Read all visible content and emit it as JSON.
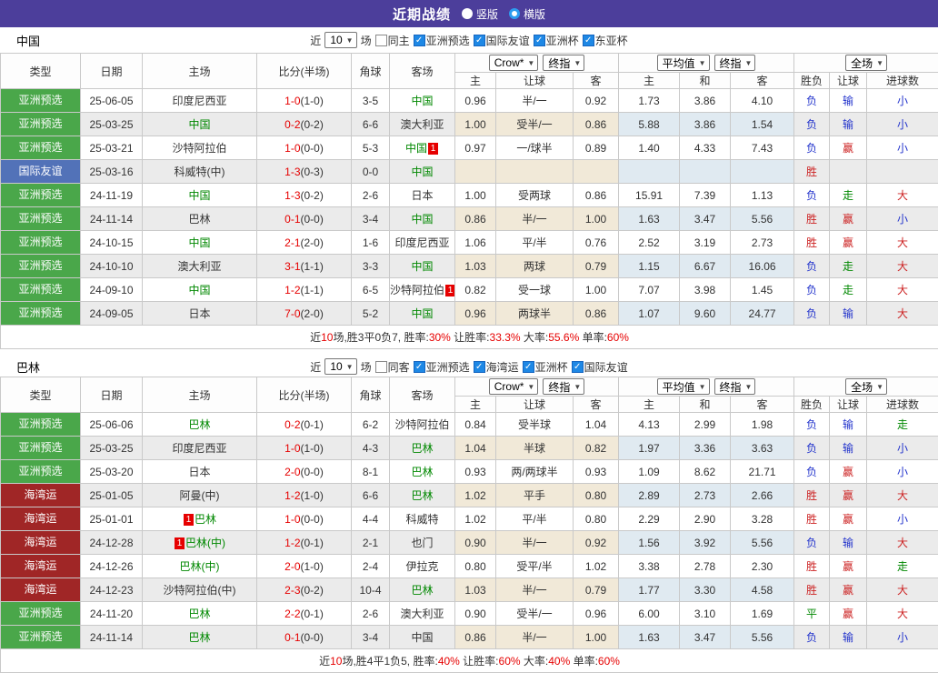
{
  "header": {
    "title": "近期战绩",
    "radio_vertical": "竖版",
    "radio_horizontal": "横版"
  },
  "columns": {
    "type": "类型",
    "date": "日期",
    "home": "主场",
    "score": "比分(半场)",
    "corner": "角球",
    "away": "客场",
    "odds_provider": "Crow*",
    "odds_final": "终指",
    "odds_home": "主",
    "odds_handicap": "让球",
    "odds_away": "客",
    "avg_label": "平均值",
    "avg_final": "终指",
    "avg_home": "主",
    "avg_draw": "和",
    "avg_away": "客",
    "full_label": "全场",
    "res_wl": "胜负",
    "res_handicap": "让球",
    "res_goals": "进球数"
  },
  "sections": [
    {
      "team": "中国",
      "filter": {
        "near": "近",
        "count": "10",
        "games": "场",
        "same": "同主",
        "comps": [
          "亚洲预选",
          "国际友谊",
          "亚洲杯",
          "东亚杯"
        ]
      },
      "rows": [
        {
          "type": "亚洲预选",
          "tc": "green",
          "date": "25-06-05",
          "home": "印度尼西亚",
          "score": "1-0",
          "half": "1-0",
          "corner": "3-5",
          "away": "中国",
          "ah": true,
          "o1": "0.96",
          "o2": "半/一",
          "o3": "0.92",
          "a1": "1.73",
          "a2": "3.86",
          "a3": "4.10",
          "r1": "负",
          "c1": "blue",
          "r2": "输",
          "c2": "blue",
          "r3": "小",
          "c3": "blue"
        },
        {
          "type": "亚洲预选",
          "tc": "green",
          "date": "25-03-25",
          "home": "中国",
          "hh": true,
          "score": "0-2",
          "half": "0-2",
          "corner": "6-6",
          "away": "澳大利亚",
          "o1": "1.00",
          "o2": "受半/一",
          "o3": "0.86",
          "a1": "5.88",
          "a2": "3.86",
          "a3": "1.54",
          "r1": "负",
          "c1": "blue",
          "r2": "输",
          "c2": "blue",
          "r3": "小",
          "c3": "blue"
        },
        {
          "type": "亚洲预选",
          "tc": "green",
          "date": "25-03-21",
          "home": "沙特阿拉伯",
          "score": "1-0",
          "half": "0-0",
          "corner": "5-3",
          "away": "中国",
          "ah": true,
          "acard": "1",
          "o1": "0.97",
          "o2": "一/球半",
          "o3": "0.89",
          "a1": "1.40",
          "a2": "4.33",
          "a3": "7.43",
          "r1": "负",
          "c1": "blue",
          "r2": "赢",
          "c2": "red",
          "r3": "小",
          "c3": "blue"
        },
        {
          "type": "国际友谊",
          "tc": "blue",
          "date": "25-03-16",
          "home": "科威特(中)",
          "score": "1-3",
          "half": "0-3",
          "corner": "0-0",
          "away": "中国",
          "ah": true,
          "o1": "",
          "o2": "",
          "o3": "",
          "a1": "",
          "a2": "",
          "a3": "",
          "r1": "胜",
          "c1": "red",
          "r2": "",
          "r3": ""
        },
        {
          "type": "亚洲预选",
          "tc": "green",
          "date": "24-11-19",
          "home": "中国",
          "hh": true,
          "score": "1-3",
          "half": "0-2",
          "corner": "2-6",
          "away": "日本",
          "o1": "1.00",
          "o2": "受两球",
          "o3": "0.86",
          "a1": "15.91",
          "a2": "7.39",
          "a3": "1.13",
          "r1": "负",
          "c1": "blue",
          "r2": "走",
          "c2": "green",
          "r3": "大",
          "c3": "red"
        },
        {
          "type": "亚洲预选",
          "tc": "green",
          "date": "24-11-14",
          "home": "巴林",
          "score": "0-1",
          "half": "0-0",
          "corner": "3-4",
          "away": "中国",
          "ah": true,
          "o1": "0.86",
          "o2": "半/一",
          "o3": "1.00",
          "a1": "1.63",
          "a2": "3.47",
          "a3": "5.56",
          "r1": "胜",
          "c1": "red",
          "r2": "赢",
          "c2": "red",
          "r3": "小",
          "c3": "blue"
        },
        {
          "type": "亚洲预选",
          "tc": "green",
          "date": "24-10-15",
          "home": "中国",
          "hh": true,
          "score": "2-1",
          "half": "2-0",
          "corner": "1-6",
          "away": "印度尼西亚",
          "o1": "1.06",
          "o2": "平/半",
          "o3": "0.76",
          "a1": "2.52",
          "a2": "3.19",
          "a3": "2.73",
          "r1": "胜",
          "c1": "red",
          "r2": "赢",
          "c2": "red",
          "r3": "大",
          "c3": "red"
        },
        {
          "type": "亚洲预选",
          "tc": "green",
          "date": "24-10-10",
          "home": "澳大利亚",
          "score": "3-1",
          "half": "1-1",
          "corner": "3-3",
          "away": "中国",
          "ah": true,
          "o1": "1.03",
          "o2": "两球",
          "o3": "0.79",
          "a1": "1.15",
          "a2": "6.67",
          "a3": "16.06",
          "r1": "负",
          "c1": "blue",
          "r2": "走",
          "c2": "green",
          "r3": "大",
          "c3": "red"
        },
        {
          "type": "亚洲预选",
          "tc": "green",
          "date": "24-09-10",
          "home": "中国",
          "hh": true,
          "score": "1-2",
          "half": "1-1",
          "corner": "6-5",
          "away": "沙特阿拉伯",
          "acard": "1",
          "o1": "0.82",
          "o2": "受一球",
          "o3": "1.00",
          "a1": "7.07",
          "a2": "3.98",
          "a3": "1.45",
          "r1": "负",
          "c1": "blue",
          "r2": "走",
          "c2": "green",
          "r3": "大",
          "c3": "red"
        },
        {
          "type": "亚洲预选",
          "tc": "green",
          "date": "24-09-05",
          "home": "日本",
          "score": "7-0",
          "half": "2-0",
          "corner": "5-2",
          "away": "中国",
          "ah": true,
          "o1": "0.96",
          "o2": "两球半",
          "o3": "0.86",
          "a1": "1.07",
          "a2": "9.60",
          "a3": "24.77",
          "r1": "负",
          "c1": "blue",
          "r2": "输",
          "c2": "blue",
          "r3": "大",
          "c3": "red"
        }
      ],
      "summary": [
        {
          "t": "近"
        },
        {
          "t": "10",
          "red": true
        },
        {
          "t": "场,胜3平0负7, 胜率:"
        },
        {
          "t": "30%",
          "red": true
        },
        {
          "t": " 让胜率:"
        },
        {
          "t": "33.3%",
          "red": true
        },
        {
          "t": " 大率:"
        },
        {
          "t": "55.6%",
          "red": true
        },
        {
          "t": " 单率:"
        },
        {
          "t": "60%",
          "red": true
        }
      ]
    },
    {
      "team": "巴林",
      "filter": {
        "near": "近",
        "count": "10",
        "games": "场",
        "same": "同客",
        "comps": [
          "亚洲预选",
          "海湾运",
          "亚洲杯",
          "国际友谊"
        ]
      },
      "rows": [
        {
          "type": "亚洲预选",
          "tc": "green",
          "date": "25-06-06",
          "home": "巴林",
          "hh": true,
          "score": "0-2",
          "half": "0-1",
          "corner": "6-2",
          "away": "沙特阿拉伯",
          "o1": "0.84",
          "o2": "受半球",
          "o3": "1.04",
          "a1": "4.13",
          "a2": "2.99",
          "a3": "1.98",
          "r1": "负",
          "c1": "blue",
          "r2": "输",
          "c2": "blue",
          "r3": "走",
          "c3": "green"
        },
        {
          "type": "亚洲预选",
          "tc": "green",
          "date": "25-03-25",
          "home": "印度尼西亚",
          "score": "1-0",
          "half": "1-0",
          "corner": "4-3",
          "away": "巴林",
          "ah": true,
          "o1": "1.04",
          "o2": "半球",
          "o3": "0.82",
          "a1": "1.97",
          "a2": "3.36",
          "a3": "3.63",
          "r1": "负",
          "c1": "blue",
          "r2": "输",
          "c2": "blue",
          "r3": "小",
          "c3": "blue"
        },
        {
          "type": "亚洲预选",
          "tc": "green",
          "date": "25-03-20",
          "home": "日本",
          "score": "2-0",
          "half": "0-0",
          "corner": "8-1",
          "away": "巴林",
          "ah": true,
          "o1": "0.93",
          "o2": "两/两球半",
          "o3": "0.93",
          "a1": "1.09",
          "a2": "8.62",
          "a3": "21.71",
          "r1": "负",
          "c1": "blue",
          "r2": "赢",
          "c2": "red",
          "r3": "小",
          "c3": "blue"
        },
        {
          "type": "海湾运",
          "tc": "darkred",
          "date": "25-01-05",
          "home": "阿曼(中)",
          "score": "1-2",
          "half": "1-0",
          "corner": "6-6",
          "away": "巴林",
          "ah": true,
          "o1": "1.02",
          "o2": "平手",
          "o3": "0.80",
          "a1": "2.89",
          "a2": "2.73",
          "a3": "2.66",
          "r1": "胜",
          "c1": "red",
          "r2": "赢",
          "c2": "red",
          "r3": "大",
          "c3": "red"
        },
        {
          "type": "海湾运",
          "tc": "darkred",
          "date": "25-01-01",
          "home": "巴林",
          "hh": true,
          "hcard": "1",
          "score": "1-0",
          "half": "0-0",
          "corner": "4-4",
          "away": "科威特",
          "o1": "1.02",
          "o2": "平/半",
          "o3": "0.80",
          "a1": "2.29",
          "a2": "2.90",
          "a3": "3.28",
          "r1": "胜",
          "c1": "red",
          "r2": "赢",
          "c2": "red",
          "r3": "小",
          "c3": "blue"
        },
        {
          "type": "海湾运",
          "tc": "darkred",
          "date": "24-12-28",
          "home": "巴林(中)",
          "hh": true,
          "hcard": "1",
          "score": "1-2",
          "half": "0-1",
          "corner": "2-1",
          "away": "也门",
          "o1": "0.90",
          "o2": "半/一",
          "o3": "0.92",
          "a1": "1.56",
          "a2": "3.92",
          "a3": "5.56",
          "r1": "负",
          "c1": "blue",
          "r2": "输",
          "c2": "blue",
          "r3": "大",
          "c3": "red"
        },
        {
          "type": "海湾运",
          "tc": "darkred",
          "date": "24-12-26",
          "home": "巴林(中)",
          "hh": true,
          "score": "2-0",
          "half": "1-0",
          "corner": "2-4",
          "away": "伊拉克",
          "o1": "0.80",
          "o2": "受平/半",
          "o3": "1.02",
          "a1": "3.38",
          "a2": "2.78",
          "a3": "2.30",
          "r1": "胜",
          "c1": "red",
          "r2": "赢",
          "c2": "red",
          "r3": "走",
          "c3": "green"
        },
        {
          "type": "海湾运",
          "tc": "darkred",
          "date": "24-12-23",
          "home": "沙特阿拉伯(中)",
          "score": "2-3",
          "half": "0-2",
          "corner": "10-4",
          "away": "巴林",
          "ah": true,
          "o1": "1.03",
          "o2": "半/一",
          "o3": "0.79",
          "a1": "1.77",
          "a2": "3.30",
          "a3": "4.58",
          "r1": "胜",
          "c1": "red",
          "r2": "赢",
          "c2": "red",
          "r3": "大",
          "c3": "red"
        },
        {
          "type": "亚洲预选",
          "tc": "green",
          "date": "24-11-20",
          "home": "巴林",
          "hh": true,
          "score": "2-2",
          "half": "0-1",
          "corner": "2-6",
          "away": "澳大利亚",
          "o1": "0.90",
          "o2": "受半/一",
          "o3": "0.96",
          "a1": "6.00",
          "a2": "3.10",
          "a3": "1.69",
          "r1": "平",
          "c1": "green",
          "r2": "赢",
          "c2": "red",
          "r3": "大",
          "c3": "red"
        },
        {
          "type": "亚洲预选",
          "tc": "green",
          "date": "24-11-14",
          "home": "巴林",
          "hh": true,
          "score": "0-1",
          "half": "0-0",
          "corner": "3-4",
          "away": "中国",
          "o1": "0.86",
          "o2": "半/一",
          "o3": "1.00",
          "a1": "1.63",
          "a2": "3.47",
          "a3": "5.56",
          "r1": "负",
          "c1": "blue",
          "r2": "输",
          "c2": "blue",
          "r3": "小",
          "c3": "blue"
        }
      ],
      "summary": [
        {
          "t": "近"
        },
        {
          "t": "10",
          "red": true
        },
        {
          "t": "场,胜4平1负5, 胜率:"
        },
        {
          "t": "40%",
          "red": true
        },
        {
          "t": " 让胜率:"
        },
        {
          "t": "60%",
          "red": true
        },
        {
          "t": " 大率:"
        },
        {
          "t": "40%",
          "red": true
        },
        {
          "t": " 单率:"
        },
        {
          "t": "60%",
          "red": true
        }
      ]
    }
  ],
  "colors": {
    "topbar": "#4c3e9b",
    "badge_green": "#4aa74a",
    "badge_blue": "#5272b8",
    "badge_darkred": "#a02626",
    "team_highlight": "#008800",
    "score_red": "#e60000",
    "result_red": "#cc2222",
    "result_blue": "#2233cc",
    "result_green": "#008800",
    "odds_bg": "#fbf4e6",
    "avg_bg": "#eaf3fa",
    "checkbox_blue": "#1e88e5"
  }
}
